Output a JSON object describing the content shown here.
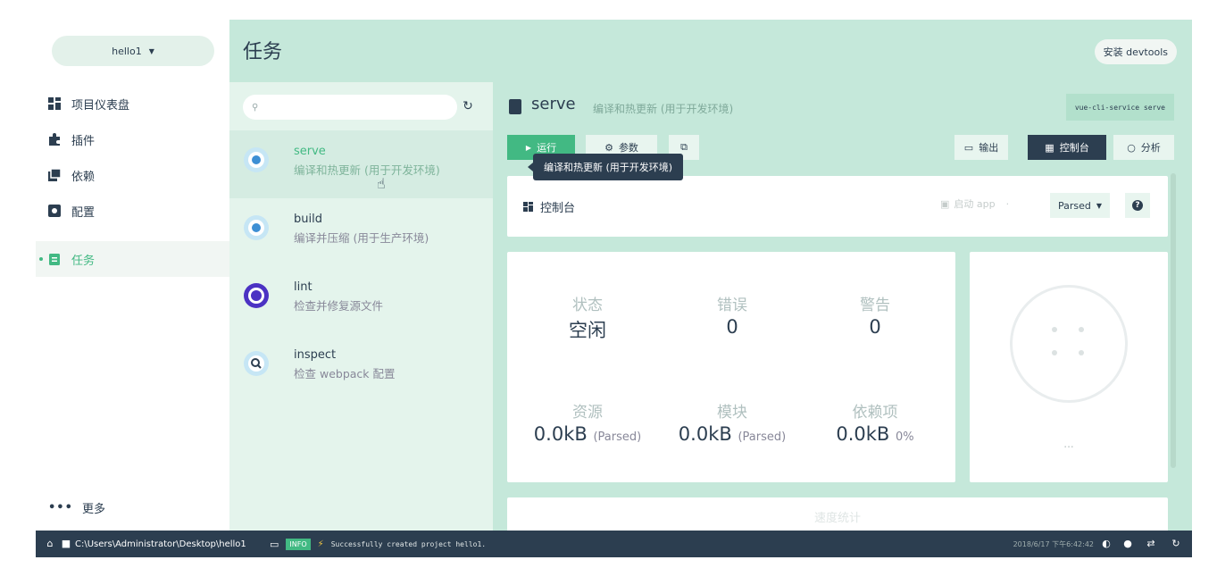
{
  "nav": {
    "project": "hello1",
    "items": [
      {
        "label": "项目仪表盘",
        "icon": "dashboard-icon"
      },
      {
        "label": "插件",
        "icon": "puzzle-icon"
      },
      {
        "label": "依赖",
        "icon": "dependencies-icon"
      },
      {
        "label": "配置",
        "icon": "settings-icon"
      },
      {
        "label": "任务",
        "icon": "clipboard-icon"
      }
    ],
    "more": "更多"
  },
  "header": {
    "title": "任务",
    "devtools": "安装 devtools"
  },
  "tasks": {
    "search_placeholder": "",
    "items": [
      {
        "name": "serve",
        "desc": "编译和热更新 (用于开发环境)",
        "icon": "vue-cli-icon",
        "active": true
      },
      {
        "name": "build",
        "desc": "编译并压缩 (用于生产环境)",
        "icon": "vue-cli-icon"
      },
      {
        "name": "lint",
        "desc": "检查并修复源文件",
        "icon": "eslint-icon"
      },
      {
        "name": "inspect",
        "desc": "检查 webpack 配置",
        "icon": "inspect-icon"
      }
    ]
  },
  "task": {
    "name": "serve",
    "desc": "编译和热更新 (用于开发环境)",
    "command": "vue-cli-service serve",
    "run": "运行",
    "params": "参数",
    "output": "输出",
    "console": "控制台",
    "analyze": "分析",
    "tooltip": "编译和热更新 (用于开发环境)"
  },
  "console_bar": {
    "title": "控制台",
    "start_app": "启动 app",
    "parsed": "Parsed"
  },
  "stats": {
    "status_label": "状态",
    "status_value": "空闲",
    "errors_label": "错误",
    "errors_value": "0",
    "warnings_label": "警告",
    "warnings_value": "0",
    "assets_label": "资源",
    "assets_value": "0.0kB",
    "assets_note": "(Parsed)",
    "modules_label": "模块",
    "modules_value": "0.0kB",
    "modules_note": "(Parsed)",
    "deps_label": "依赖项",
    "deps_value": "0.0kB",
    "deps_note": "0%"
  },
  "chart_more": "...",
  "bottom_faint": "速度统计",
  "statusbar": {
    "path": "C:\\Users\\Administrator\\Desktop\\hello1",
    "badge": "INFO",
    "message": "Successfully created project hello1.",
    "time": "2018/6/17 下午6:42:42"
  },
  "colors": {
    "accent": "#42b983",
    "dark": "#2c3e50",
    "header_bg": "#c5e8da",
    "list_bg": "#e4f4ec"
  }
}
